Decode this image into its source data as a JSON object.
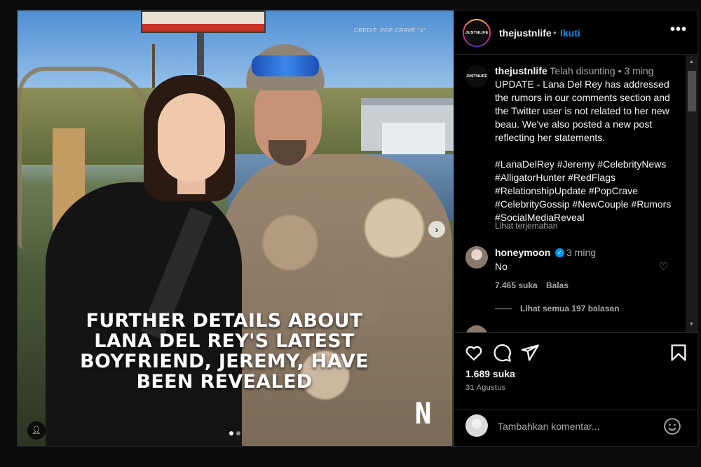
{
  "post": {
    "credit": "CREDIT: POP CRAVE \"X\"",
    "headline": "FURTHER DETAILS ABOUT LANA DEL REY'S LATEST BOYFRIEND, JEREMY, HAVE BEEN REVEALED",
    "watermark": "N",
    "media_index": 1,
    "media_count": 2
  },
  "header": {
    "username": "thejustnlife",
    "separator": "•",
    "follow_label": "Ikuti",
    "avatar_text": "JUSTNLIFE",
    "more_icon": "more-horizontal-icon"
  },
  "caption": {
    "username": "thejustnlife",
    "edited": "Telah disunting",
    "bullet": "•",
    "time": "3 ming",
    "text": "UPDATE - Lana Del Rey has addressed the rumors in our comments section and the Twitter user is not related to her new beau. We've also posted a new post reflecting her statements.",
    "hashtags": "#LanaDelRey #Jeremy #CelebrityNews #AlligatorHunter #RedFlags #RelationshipUpdate #PopCrave #CelebrityGossip #NewCouple #Rumors #SocialMediaReveal",
    "translate": "Lihat terjemahan"
  },
  "comment": {
    "username": "honeymoon",
    "time": "3 ming",
    "text": "No",
    "likes": "7.465 suka",
    "reply_label": "Balas",
    "view_replies": "Lihat semua 197 balasan"
  },
  "actions": {
    "likes": "1.689 suka",
    "date": "31 Agustus"
  },
  "add_comment": {
    "placeholder": "Tambahkan komentar..."
  },
  "colors": {
    "accent": "#0095f6",
    "muted": "#a8a8a8",
    "background": "#000000"
  }
}
